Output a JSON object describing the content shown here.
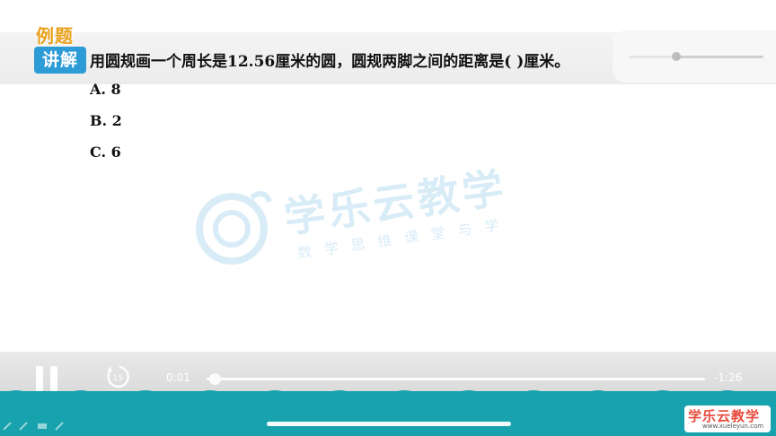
{
  "badge": {
    "line1": "例题",
    "line2": "讲解"
  },
  "question": {
    "text": "用圆规画一个周长是12.56厘米的圆，圆规两脚之间的距离是(    )厘米。",
    "options": [
      "A. 8",
      "B. 2",
      "C. 6"
    ]
  },
  "watermark": {
    "title": "学乐云教学",
    "subtitle": "数学思维课堂与学"
  },
  "volume": {
    "level": 0.35
  },
  "player": {
    "current_time": "0:01",
    "remaining_time": "-1:26",
    "progress": 0.01,
    "replay_seconds": "15"
  },
  "brand": {
    "name": "学乐云教学",
    "url": "www.xueleyun.com"
  },
  "colors": {
    "teal": "#17a2ad",
    "badge_blue": "#2c9bd6",
    "badge_orange": "#e8a11d",
    "brand_red": "#e94b3c"
  }
}
